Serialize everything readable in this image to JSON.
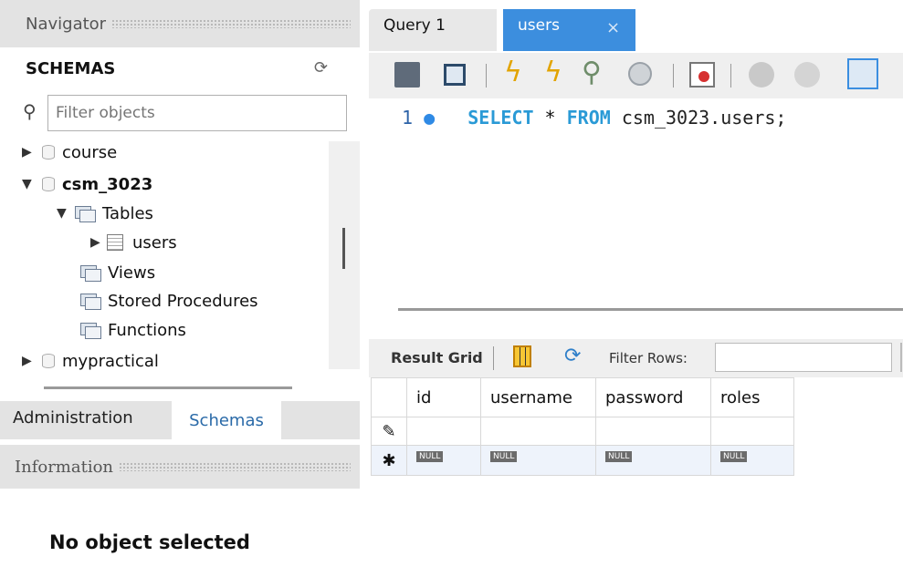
{
  "navigator": {
    "title": "Navigator",
    "schemas_title": "SCHEMAS",
    "filter_placeholder": "Filter objects",
    "tree": {
      "course": "course",
      "csm": "csm_3023",
      "tables": "Tables",
      "users": "users",
      "views": "Views",
      "stored_procedures": "Stored Procedures",
      "functions": "Functions",
      "mypractical": "mypractical"
    },
    "tabs": {
      "administration": "Administration",
      "schemas": "Schemas"
    },
    "info_title": "Information",
    "no_object": "No object selected"
  },
  "editor": {
    "tabs": {
      "query1": "Query 1",
      "users": "users"
    },
    "close_glyph": "×",
    "line_number": "1",
    "sql": {
      "select": "SELECT",
      "star": " * ",
      "from": "FROM",
      "rest": " csm_3023.users;"
    }
  },
  "result": {
    "label": "Result Grid",
    "filter_label": "Filter Rows:",
    "columns": [
      "id",
      "username",
      "password",
      "roles"
    ],
    "null_text": "NULL"
  },
  "colors": {
    "active_tab": "#3c8ede",
    "keyword": "#2a9ad6",
    "schemas_tab_text": "#2a6aa8"
  }
}
